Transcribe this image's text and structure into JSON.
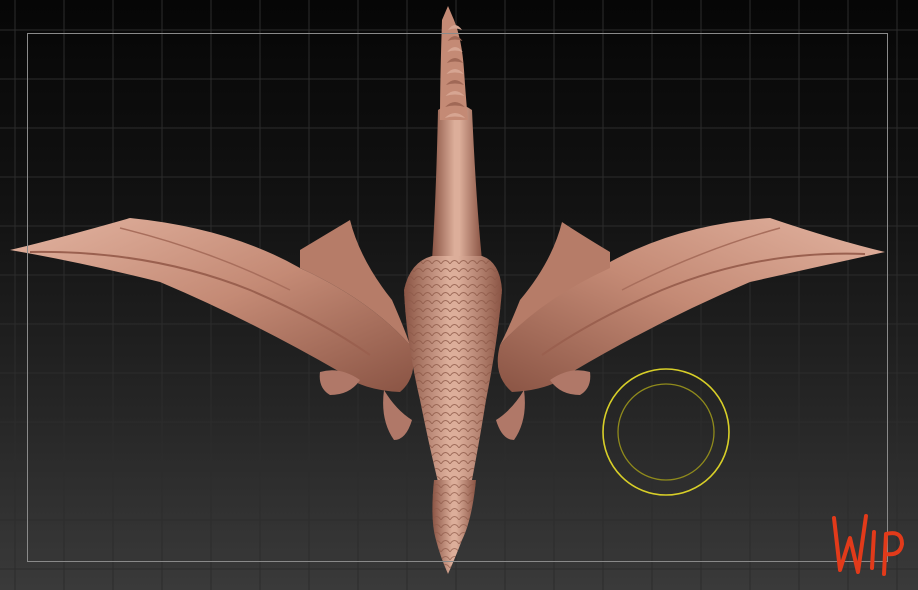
{
  "canvas": {
    "background_top": "#060606",
    "background_bottom": "#3a3a3a",
    "grid_color": "#2c2c2c",
    "frame_color": "#8a8a8a"
  },
  "model": {
    "subject": "dragon-sculpt",
    "material_color": "#c98e7a",
    "highlight_color": "#e7b9a6",
    "shadow_color": "#7a4a3c"
  },
  "brush_cursor": {
    "outer_color": "#d8cf28",
    "inner_color": "#8f8a1c",
    "icon": "brush-cursor-icon"
  },
  "stamp": {
    "text": "WIP",
    "color": "#e23a1a"
  }
}
